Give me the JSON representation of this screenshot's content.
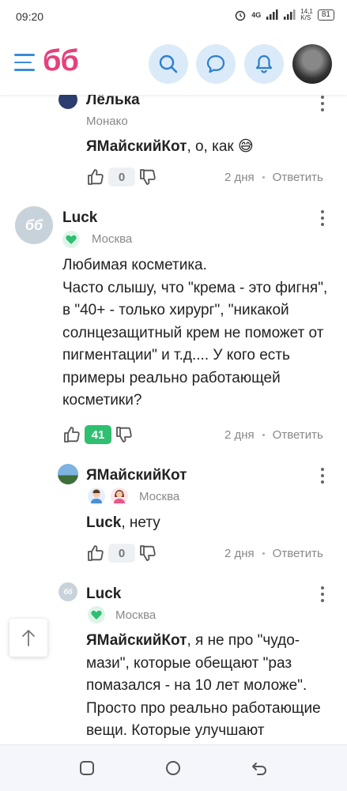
{
  "status": {
    "time": "09:20",
    "net": "4G",
    "speed": "14,1\nK/S",
    "battery": "81"
  },
  "header": {
    "logo": "бб",
    "icons": [
      "menu-icon",
      "search-icon",
      "chat-icon",
      "bell-icon"
    ]
  },
  "comments": [
    {
      "author": "Лёлька",
      "city": "Монако",
      "mention": "ЯМайскийКот",
      "text": ", о, как 😅",
      "votes": "0",
      "time": "2 дня",
      "reply": "Ответить"
    },
    {
      "author": "Luck",
      "city": "Москва",
      "avatar_text": "бб",
      "text": "Любимая косметика.\nЧасто слышу, что \"крема - это фигня\", в \"40+ - только хирург\", \"никакой солнцезащитный крем не поможет от пигментации\" и т.д.... У кого есть примеры реально работающей косметики?",
      "votes": "41",
      "time": "2 дня",
      "reply": "Ответить"
    },
    {
      "author": "ЯМайскийКот",
      "city": "Москва",
      "mention": "Luck",
      "text": ", нету",
      "votes": "0",
      "time": "2 дня",
      "reply": "Ответить"
    },
    {
      "author": "Luck",
      "city": "Москва",
      "avatar_text": "бб",
      "mention": "ЯМайскийКот",
      "text": ", я не про \"чудо-мази\", которые обещают \"раз помазался - на 10 лет моложе\". Просто про реально работающие вещи. Которые улучшают"
    }
  ],
  "colors": {
    "accent": "#3b8bd8",
    "logo": "#e6407d",
    "positive": "#2fbf71"
  }
}
